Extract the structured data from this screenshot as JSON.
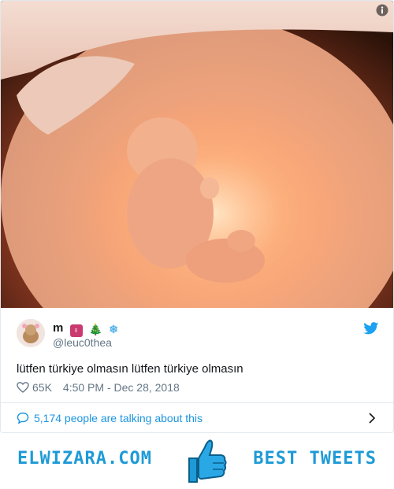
{
  "tweet": {
    "display_name": "m",
    "emojis": [
      "♀",
      "🎄",
      "❄"
    ],
    "handle": "@leuc0thea",
    "text": "lütfen türkiye olmasın lütfen türkiye olmasın",
    "likes": "65K",
    "timestamp": "4:50 PM - Dec 28, 2018",
    "talking": "5,174 people are talking about this"
  },
  "banner": {
    "left_text": "ELWIZARA.COM",
    "right_text": "BEST TWEETS"
  },
  "colors": {
    "accent": "#1b95e0",
    "brand": "#1e9ad6",
    "muted": "#657786",
    "border": "#e1e8ed"
  },
  "icons": [
    "info-icon",
    "twitter-bird-icon",
    "heart-icon",
    "speech-bubble-icon",
    "chevron-right-icon",
    "thumbs-up-icon"
  ]
}
